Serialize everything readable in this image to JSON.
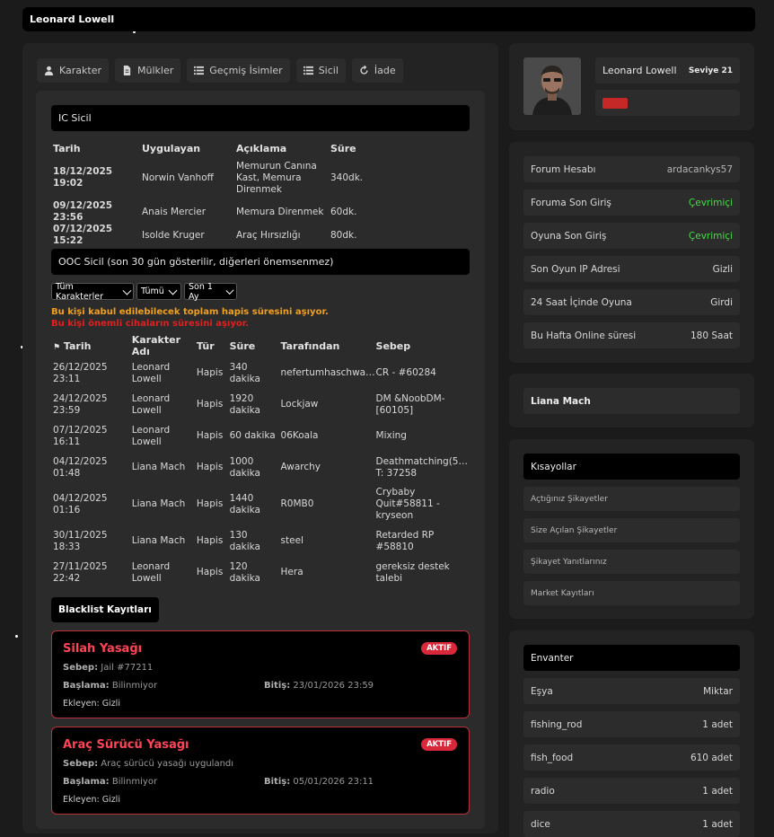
{
  "window": {
    "title": "Leonard Lowell"
  },
  "tabs": [
    {
      "label": "Karakter",
      "icon": "user-icon"
    },
    {
      "label": "Mülkler",
      "icon": "document-icon"
    },
    {
      "label": "Geçmiş İsimler",
      "icon": "list-icon"
    },
    {
      "label": "Sicil",
      "icon": "list-icon"
    },
    {
      "label": "İade",
      "icon": "refresh-icon"
    }
  ],
  "ic_sicil": {
    "title": "IC Sicil",
    "headers": [
      "Tarih",
      "Uygulayan",
      "Açıklama",
      "Süre"
    ],
    "rows": [
      {
        "date": "18/12/2025 19:02",
        "by": "Norwin Vanhoff",
        "desc": "Memurun Canına Kast, Memura Direnmek",
        "duration": "340dk."
      },
      {
        "date": "09/12/2025 23:56",
        "by": "Anais Mercier",
        "desc": "Memura Direnmek",
        "duration": "60dk."
      },
      {
        "date": "07/12/2025 15:22",
        "by": "Isolde Kruger",
        "desc": "Araç Hırsızlığı",
        "duration": "80dk."
      }
    ]
  },
  "ooc_sicil": {
    "title": "OOC Sicil (son 30 gün gösterilir, diğerleri önemsenmez)",
    "filters": [
      "Tüm Karakterler",
      "Tümü",
      "Son 1 Ay"
    ],
    "warning_orange": "Bu kişi kabul edilebilecek toplam hapis süresini aşıyor.",
    "warning_red": "Bu kişi önemli cihaların süresini aşıyor.",
    "headers": [
      "Tarih",
      "Karakter Adı",
      "Tür",
      "Süre",
      "Tarafından",
      "Sebep"
    ],
    "rows": [
      {
        "date": "26/12/2025 23:11",
        "char": "Leonard Lowell",
        "type": "Hapis",
        "duration": "340 dakika",
        "by": "nefertumhaschwa…",
        "reason": "CR - #60284"
      },
      {
        "date": "24/12/2025 23:59",
        "char": "Leonard Lowell",
        "type": "Hapis",
        "duration": "1920 dakika",
        "by": "Lockjaw",
        "reason": "DM &NoobDM-[60105]"
      },
      {
        "date": "07/12/2025 16:11",
        "char": "Leonard Lowell",
        "type": "Hapis",
        "duration": "60 dakika",
        "by": "06Koala",
        "reason": "Mixing"
      },
      {
        "date": "04/12/2025 01:48",
        "char": "Liana Mach",
        "type": "Hapis",
        "duration": "1000 dakika",
        "by": "Awarchy",
        "reason": "Deathmatching(5… T: 37258"
      },
      {
        "date": "04/12/2025 01:16",
        "char": "Liana Mach",
        "type": "Hapis",
        "duration": "1440 dakika",
        "by": "R0MB0",
        "reason": "Crybaby Quit#58811 - kryseon"
      },
      {
        "date": "30/11/2025 18:33",
        "char": "Liana Mach",
        "type": "Hapis",
        "duration": "130 dakika",
        "by": "steel",
        "reason": "Retarded RP #58810"
      },
      {
        "date": "27/11/2025 22:42",
        "char": "Leonard Lowell",
        "type": "Hapis",
        "duration": "120 dakika",
        "by": "Hera",
        "reason": "gereksiz destek talebi"
      }
    ]
  },
  "blacklist": {
    "title": "Blacklist Kayıtları",
    "items": [
      {
        "title": "Silah Yasağı",
        "badge": "AKTIF",
        "reason_label": "Sebep:",
        "reason": "Jail #77211",
        "start_label": "Başlama:",
        "start": "Bilinmiyor",
        "end_label": "Bitiş:",
        "end": "23/01/2026 23:59",
        "added": "Ekleyen: Gizli"
      },
      {
        "title": "Araç Sürücü Yasağı",
        "badge": "AKTIF",
        "reason_label": "Sebep:",
        "reason": "Araç sürücü yasağı uygulandı",
        "start_label": "Başlama:",
        "start": "Bilinmiyor",
        "end_label": "Bitiş:",
        "end": "05/01/2026 23:11",
        "added": "Ekleyen: Gizli"
      }
    ]
  },
  "profile": {
    "name": "Leonard Lowell",
    "level": "Seviye 21",
    "status_color": "#c62828"
  },
  "info": [
    {
      "label": "Forum Hesabı",
      "value": "ardacankys57",
      "style": "gray"
    },
    {
      "label": "Foruma Son Giriş",
      "value": "Çevrimiçi",
      "style": "green"
    },
    {
      "label": "Oyuna Son Giriş",
      "value": "Çevrimiçi",
      "style": "green"
    },
    {
      "label": "Son Oyun IP Adresi",
      "value": "Gizli",
      "style": ""
    },
    {
      "label": "24 Saat İçinde Oyuna",
      "value": "Girdi",
      "style": ""
    },
    {
      "label": "Bu Hafta Online süresi",
      "value": "180 Saat",
      "style": ""
    }
  ],
  "other_character": "Liana Mach",
  "shortcuts": {
    "title": "Kısayollar",
    "items": [
      "Açtığınız Şikayetler",
      "Size Açılan Şikayetler",
      "Şikayet Yanıtlarınız",
      "Market Kayıtları"
    ]
  },
  "inventory": {
    "title": "Envanter",
    "headers": [
      "Eşya",
      "Miktar"
    ],
    "items": [
      {
        "name": "fishing_rod",
        "qty": "1 adet"
      },
      {
        "name": "fish_food",
        "qty": "610 adet"
      },
      {
        "name": "radio",
        "qty": "1 adet"
      },
      {
        "name": "dice",
        "qty": "1 adet"
      }
    ]
  },
  "colors": {
    "accent_red": "#ff4455",
    "online_green": "#44dd44",
    "warning_orange": "#f0a020"
  }
}
